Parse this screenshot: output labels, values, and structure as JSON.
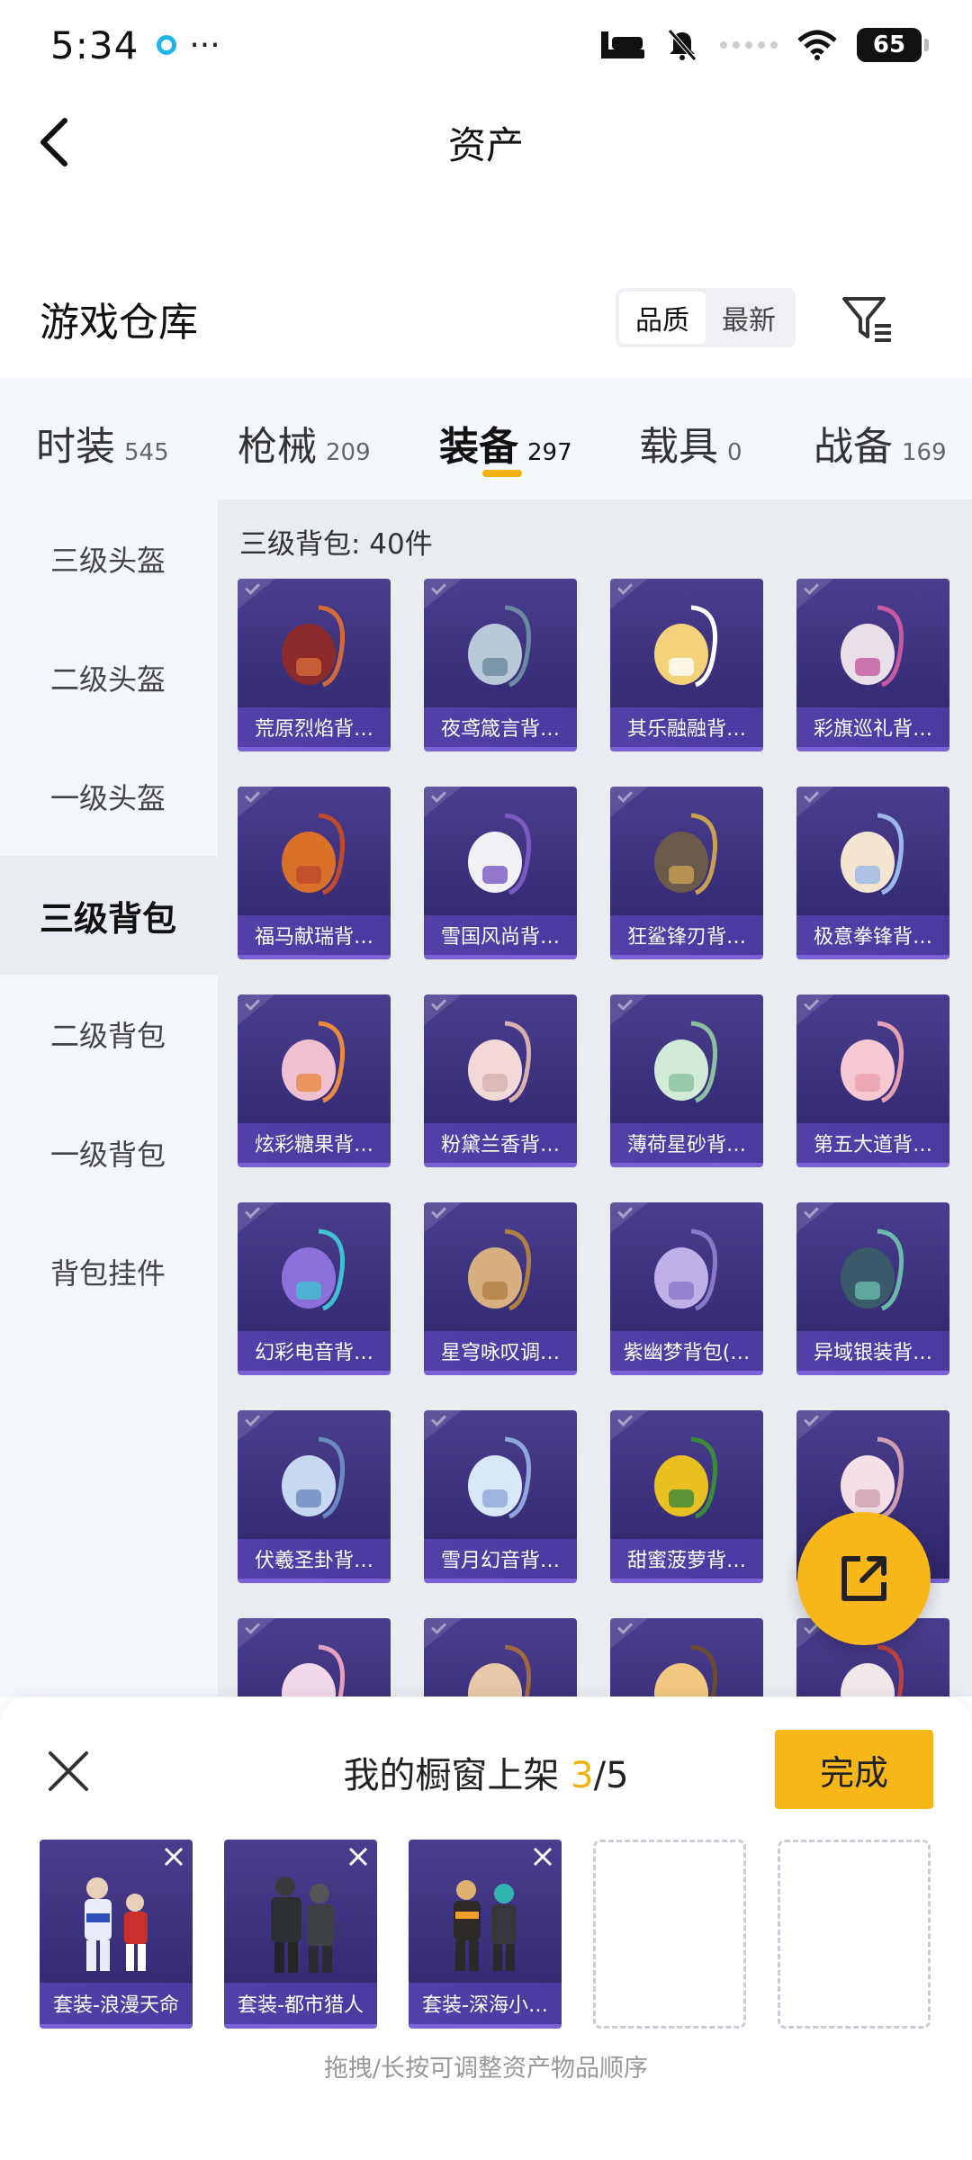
{
  "status_bar": {
    "time": "5:34",
    "more": "···",
    "battery": "65"
  },
  "header": {
    "title": "资产"
  },
  "section": {
    "title": "游戏仓库"
  },
  "sort": {
    "options": [
      "品质",
      "最新"
    ],
    "active": "品质"
  },
  "tabs": [
    {
      "label": "时装",
      "count": "545"
    },
    {
      "label": "枪械",
      "count": "209"
    },
    {
      "label": "装备",
      "count": "297",
      "active": true
    },
    {
      "label": "载具",
      "count": "0"
    },
    {
      "label": "战备",
      "count": "169"
    }
  ],
  "side_nav": [
    "三级头盔",
    "二级头盔",
    "一级头盔",
    "三级背包",
    "二级背包",
    "一级背包",
    "背包挂件"
  ],
  "side_nav_active": "三级背包",
  "grid": {
    "header": "三级背包: 40件",
    "items": [
      "荒原烈焰背…",
      "夜鸢箴言背…",
      "其乐融融背…",
      "彩旗巡礼背…",
      "福马献瑞背…",
      "雪国风尚背…",
      "狂鲨锋刃背…",
      "极意拳锋背…",
      "炫彩糖果背…",
      "粉黛兰香背…",
      "薄荷星砂背…",
      "第五大道背…",
      "幻彩电音背…",
      "星穹咏叹调…",
      "紫幽梦背包(…",
      "异域银装背…",
      "伏羲圣卦背…",
      "雪月幻音背…",
      "甜蜜菠萝背…",
      "",
      "",
      "",
      "",
      ""
    ]
  },
  "sheet": {
    "title_prefix": "我的橱窗上架 ",
    "count": "3",
    "total": "/5",
    "done": "完成",
    "slots": [
      "套装-浪漫天命",
      "套装-都市猎人",
      "套装-深海小…"
    ],
    "hint": "拖拽/长按可调整资产物品顺序"
  },
  "colors": {
    "accent": "#f8b718",
    "card": "#3a2f7a",
    "card_label": "#5340a8"
  }
}
